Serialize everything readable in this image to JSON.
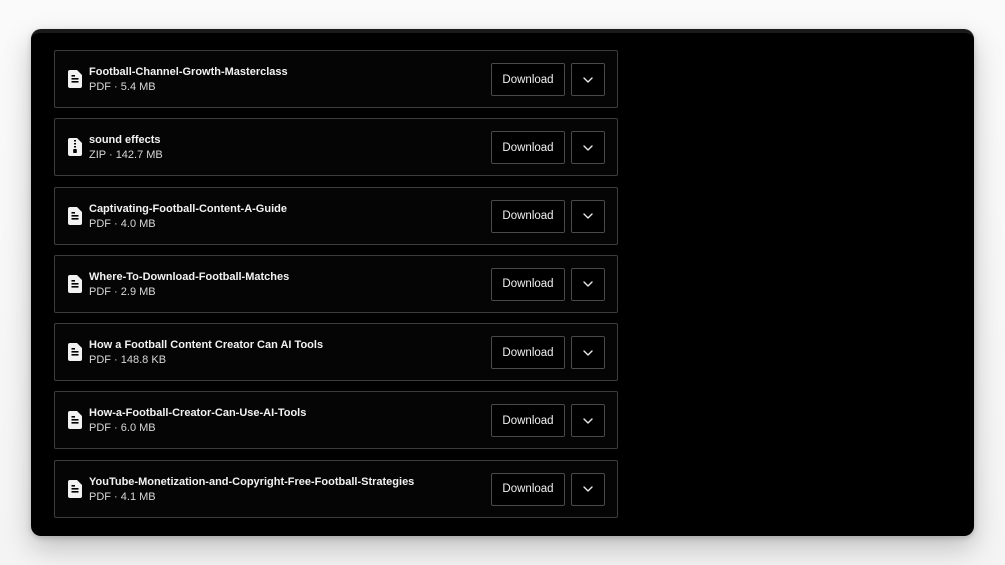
{
  "files": [
    {
      "name": "Football-Channel-Growth-Masterclass",
      "info": "PDF · 5.4 MB",
      "icon": "pdf-document-icon"
    },
    {
      "name": "sound effects",
      "info": "ZIP · 142.7 MB",
      "icon": "zip-archive-icon"
    },
    {
      "name": "Captivating-Football-Content-A-Guide",
      "info": "PDF · 4.0 MB",
      "icon": "pdf-document-icon"
    },
    {
      "name": "Where-To-Download-Football-Matches",
      "info": "PDF · 2.9 MB",
      "icon": "pdf-document-icon"
    },
    {
      "name": "How a Football Content Creator Can AI Tools",
      "info": "PDF · 148.8 KB",
      "icon": "pdf-document-icon"
    },
    {
      "name": "How-a-Football-Creator-Can-Use-AI-Tools",
      "info": "PDF · 6.0 MB",
      "icon": "pdf-document-icon"
    },
    {
      "name": "YouTube-Monetization-and-Copyright-Free-Football-Strategies",
      "info": "PDF · 4.1 MB",
      "icon": "pdf-document-icon"
    }
  ],
  "actions": {
    "download_label": "Download",
    "more_icon": "chevron-down-icon"
  },
  "colors": {
    "panel_background": "#000000",
    "card_border": "#3d3d3d",
    "text_primary": "#f2f2f2",
    "text_secondary": "#d8d8d8"
  }
}
